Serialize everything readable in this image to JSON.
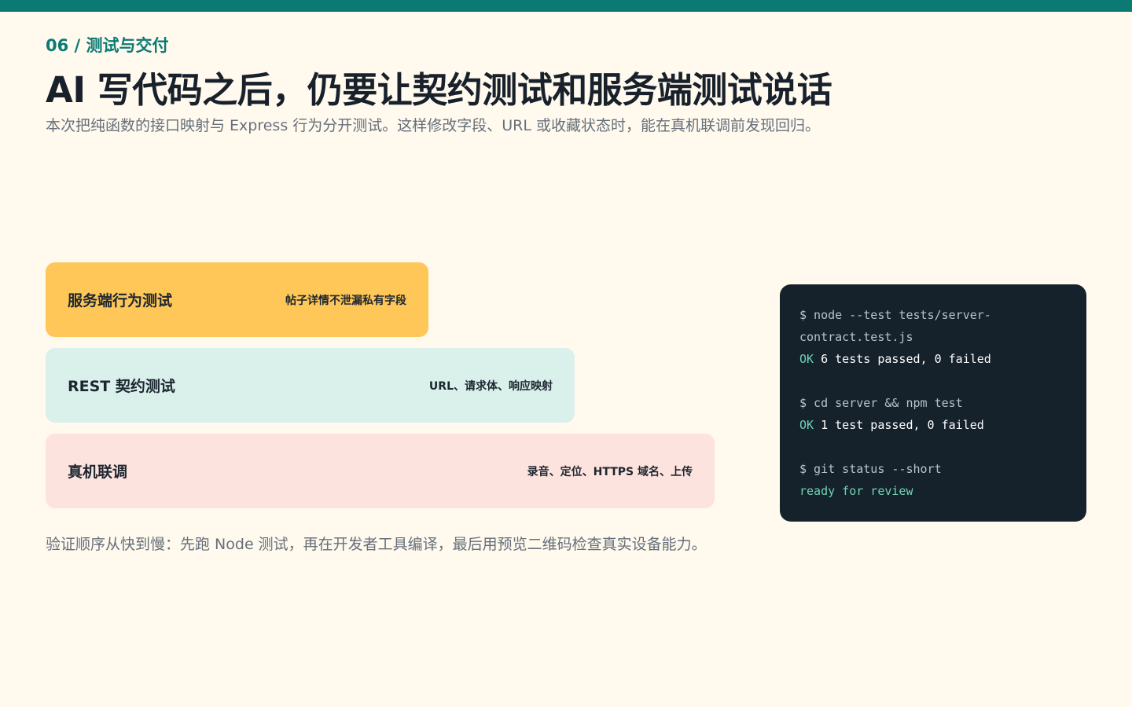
{
  "header": {
    "kicker": "06 / 测试与交付",
    "title": "AI 写代码之后，仍要让契约测试和服务端测试说话",
    "subtitle": "本次把纯函数的接口映射与 Express 行为分开测试。这样修改字段、URL 或收藏状态时，能在真机联调前发现回归。"
  },
  "layers": [
    {
      "label": "服务端行为测试",
      "note": "帖子详情不泄漏私有字段",
      "color": "#ffc757"
    },
    {
      "label": "REST 契约测试",
      "note": "URL、请求体、响应映射",
      "color": "#d9f0eb"
    },
    {
      "label": "真机联调",
      "note": "录音、定位、HTTPS 域名、上传",
      "color": "#fde3de"
    }
  ],
  "footer_note": "验证顺序从快到慢：先跑 Node 测试，再在开发者工具编译，最后用预览二维码检查真实设备能力。",
  "terminal": {
    "cmd1_a": "$ node --test tests/server-",
    "cmd1_b": "contract.test.js",
    "res1_ok": "OK",
    "res1_text": " 6 tests passed, 0 failed",
    "cmd2": "$ cd server && npm test",
    "res2_ok": "OK",
    "res2_text": " 1 test passed, 0 failed",
    "cmd3": "$ git status --short",
    "res3": "ready for review"
  },
  "colors": {
    "accent": "#0b7a73",
    "background": "#fff9ee",
    "terminal_bg": "#15212b",
    "ok_green": "#6fd3b5"
  }
}
